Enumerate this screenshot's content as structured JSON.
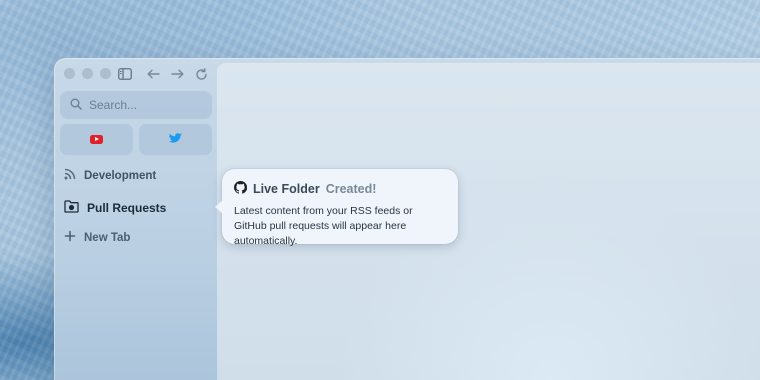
{
  "search": {
    "placeholder": "Search..."
  },
  "pinned_tabs": [
    {
      "icon": "youtube-icon",
      "color": "#e0202a"
    },
    {
      "icon": "twitter-icon",
      "color": "#1d9bf0"
    }
  ],
  "sidebar": {
    "items": [
      {
        "label": "Development",
        "icon": "rss-icon"
      },
      {
        "label": "Pull Requests",
        "icon": "github-folder-icon"
      },
      {
        "label": "New Tab",
        "icon": "plus-icon"
      }
    ]
  },
  "popover": {
    "title_main": "Live Folder",
    "title_rest": "Created!",
    "body": "Latest content from your RSS feeds or GitHub pull requests will appear here automatically."
  },
  "colors": {
    "youtube": "#e0202a",
    "twitter": "#1d9bf0"
  }
}
